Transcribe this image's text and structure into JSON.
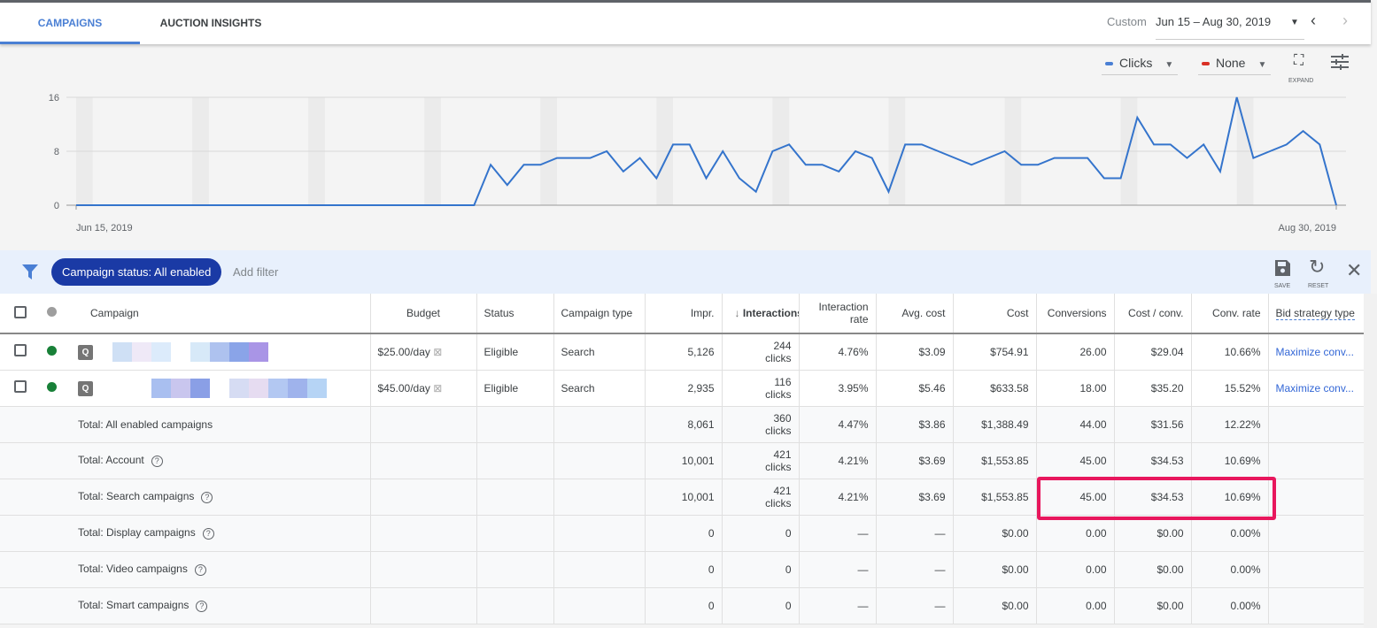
{
  "tabs": [
    {
      "label": "CAMPAIGNS",
      "active": true
    },
    {
      "label": "AUCTION INSIGHTS",
      "active": false
    }
  ],
  "date_range": {
    "preset": "Custom",
    "range": "Jun 15 – Aug 30, 2019"
  },
  "chart_controls": {
    "metric1": "Clicks",
    "metric1_color": "#4a7fd4",
    "metric2": "None",
    "metric2_color": "#d93025",
    "expand_label": "EXPAND"
  },
  "chart_data": {
    "type": "line",
    "series": [
      {
        "name": "Clicks",
        "color": "#3474cc",
        "values": [
          0,
          0,
          0,
          0,
          0,
          0,
          0,
          0,
          0,
          0,
          0,
          0,
          0,
          0,
          0,
          0,
          0,
          0,
          0,
          0,
          0,
          0,
          0,
          0,
          0,
          6,
          3,
          6,
          6,
          7,
          7,
          7,
          8,
          5,
          7,
          4,
          9,
          9,
          4,
          8,
          4,
          2,
          8,
          9,
          6,
          6,
          5,
          8,
          7,
          2,
          9,
          9,
          8,
          7,
          6,
          7,
          8,
          6,
          6,
          7,
          7,
          7,
          4,
          4,
          13,
          9,
          9,
          7,
          9,
          5,
          16,
          7,
          8,
          9,
          11,
          9,
          0
        ]
      }
    ],
    "x_start": "Jun 15, 2019",
    "x_end": "Aug 30, 2019",
    "x_tick_labels": [
      "Jun 15, 2019",
      "Aug 30, 2019"
    ],
    "y_ticks": [
      0,
      8,
      16
    ],
    "ylim": [
      0,
      16
    ],
    "grid": true,
    "weekend_shading": true
  },
  "filter": {
    "chip": "Campaign status: All enabled",
    "add": "Add filter",
    "save": "SAVE",
    "reset": "RESET"
  },
  "table": {
    "headers": [
      "Campaign",
      "Budget",
      "Status",
      "Campaign type",
      "Impr.",
      "Interactions",
      "Interaction rate",
      "Avg. cost",
      "Cost",
      "Conversions",
      "Cost / conv.",
      "Conv. rate",
      "Bid strategy type"
    ],
    "sorted_column": "Interactions",
    "rows": [
      {
        "budget": "$25.00/day",
        "status": "Eligible",
        "type": "Search",
        "impr": "5,126",
        "inter": "244",
        "inter_unit": "clicks",
        "rate": "4.76%",
        "avg": "$3.09",
        "cost": "$754.91",
        "conv": "26.00",
        "cpc": "$29.04",
        "cr": "10.66%",
        "bid": "Maximize conv..."
      },
      {
        "budget": "$45.00/day",
        "status": "Eligible",
        "type": "Search",
        "impr": "2,935",
        "inter": "116",
        "inter_unit": "clicks",
        "rate": "3.95%",
        "avg": "$5.46",
        "cost": "$633.58",
        "conv": "18.00",
        "cpc": "$35.20",
        "cr": "15.52%",
        "bid": "Maximize conv..."
      }
    ],
    "totals": [
      {
        "label": "Total: All enabled campaigns",
        "help": false,
        "impr": "8,061",
        "inter": "360",
        "inter_unit": "clicks",
        "rate": "4.47%",
        "avg": "$3.86",
        "cost": "$1,388.49",
        "conv": "44.00",
        "cpc": "$31.56",
        "cr": "12.22%"
      },
      {
        "label": "Total: Account",
        "help": true,
        "impr": "10,001",
        "inter": "421",
        "inter_unit": "clicks",
        "rate": "4.21%",
        "avg": "$3.69",
        "cost": "$1,553.85",
        "conv": "45.00",
        "cpc": "$34.53",
        "cr": "10.69%"
      },
      {
        "label": "Total: Search campaigns",
        "help": true,
        "impr": "10,001",
        "inter": "421",
        "inter_unit": "clicks",
        "rate": "4.21%",
        "avg": "$3.69",
        "cost": "$1,553.85",
        "conv": "45.00",
        "cpc": "$34.53",
        "cr": "10.69%"
      },
      {
        "label": "Total: Display campaigns",
        "help": true,
        "impr": "0",
        "inter": "0",
        "inter_unit": "",
        "rate": "—",
        "avg": "—",
        "cost": "$0.00",
        "conv": "0.00",
        "cpc": "$0.00",
        "cr": "0.00%"
      },
      {
        "label": "Total: Video campaigns",
        "help": true,
        "impr": "0",
        "inter": "0",
        "inter_unit": "",
        "rate": "—",
        "avg": "—",
        "cost": "$0.00",
        "conv": "0.00",
        "cpc": "$0.00",
        "cr": "0.00%"
      },
      {
        "label": "Total: Smart campaigns",
        "help": true,
        "impr": "0",
        "inter": "0",
        "inter_unit": "",
        "rate": "—",
        "avg": "—",
        "cost": "$0.00",
        "conv": "0.00",
        "cpc": "$0.00",
        "cr": "0.00%"
      }
    ]
  },
  "highlight_color": "#e8175d"
}
